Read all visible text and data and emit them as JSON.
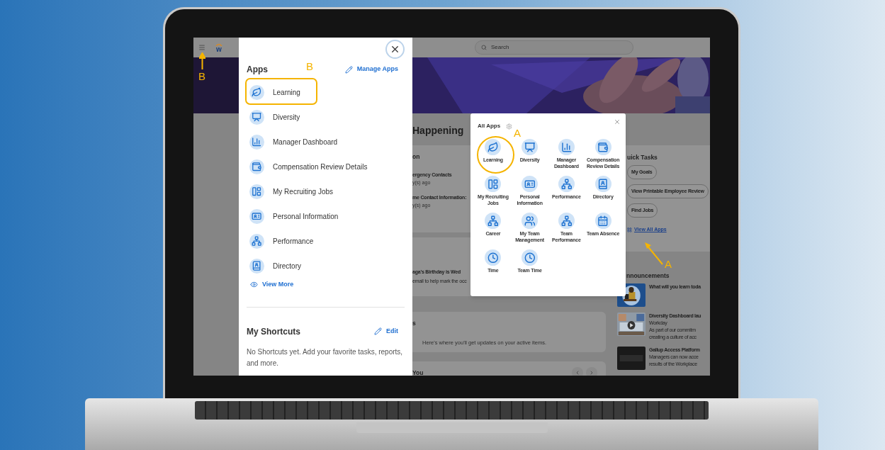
{
  "screen": {
    "top_bar": {
      "logo_text": "w",
      "search": {
        "placeholder": "Search"
      }
    },
    "apps_drawer": {
      "title": "Apps",
      "manage_link": "Manage Apps",
      "items": [
        {
          "label": "Learning"
        },
        {
          "label": "Diversity"
        },
        {
          "label": "Manager Dashboard"
        },
        {
          "label": "Compensation Review Details"
        },
        {
          "label": "My Recruiting Jobs"
        },
        {
          "label": "Personal Information"
        },
        {
          "label": "Performance"
        },
        {
          "label": "Directory"
        }
      ],
      "view_more": "View More",
      "shortcuts": {
        "title": "My Shortcuts",
        "edit": "Edit",
        "empty_text": "No Shortcuts yet. Add your favorite tasks, reports, and more."
      }
    },
    "dashboard": {
      "heading": "Happening",
      "cards": [
        {
          "lines": [
            {
              "kind": "title",
              "text": "on"
            },
            {
              "kind": "bold",
              "text": "ergency Contacts"
            },
            {
              "kind": "meta",
              "text": "y(s) ago"
            },
            {
              "kind": "bold",
              "text": "me Contact Information:"
            },
            {
              "kind": "meta",
              "text": "y(s) ago"
            }
          ]
        },
        {
          "lines": [
            {
              "kind": "bold",
              "text": "aga's Birthday is Wed"
            },
            {
              "kind": "body",
              "text": "email to help mark the occ"
            }
          ]
        },
        {
          "lines": [
            {
              "kind": "title",
              "text": "s"
            },
            {
              "kind": "note",
              "text": "Here's where you'll get updates on your active items."
            }
          ]
        },
        {
          "lines": [
            {
              "kind": "title",
              "text": "You"
            }
          ],
          "pager": true
        }
      ],
      "quick_tasks": {
        "title": "uick Tasks",
        "buttons": [
          "My Goals",
          "View Printable Employee Review",
          "Find Jobs"
        ],
        "view_all": "View All Apps"
      },
      "announcements": {
        "title": "nnouncements",
        "items": [
          {
            "title": "What will you learn toda"
          },
          {
            "title": "Diversity Dashboard lau",
            "body": [
              "Workday",
              "As part of our commitm",
              "creating a culture of acc"
            ]
          },
          {
            "title": "Gallup Access Platform",
            "body": [
              "Managers can now acce",
              "results of the Workplace"
            ]
          }
        ]
      }
    },
    "all_apps_popup": {
      "title": "All Apps",
      "items": [
        {
          "label": "Learning"
        },
        {
          "label": "Diversity"
        },
        {
          "label": "Manager Dashboard"
        },
        {
          "label": "Compensation Review Details"
        },
        {
          "label": "My Recruiting Jobs"
        },
        {
          "label": "Personal Information"
        },
        {
          "label": "Performance"
        },
        {
          "label": "Directory"
        },
        {
          "label": "Career"
        },
        {
          "label": "My Team Management"
        },
        {
          "label": "Team Performance"
        },
        {
          "label": "Team Absence"
        },
        {
          "label": "Time"
        },
        {
          "label": "Team Time"
        }
      ]
    }
  },
  "annotations": [
    {
      "text": "B"
    },
    {
      "text": "B"
    },
    {
      "text": "A"
    },
    {
      "text": "A"
    }
  ]
}
